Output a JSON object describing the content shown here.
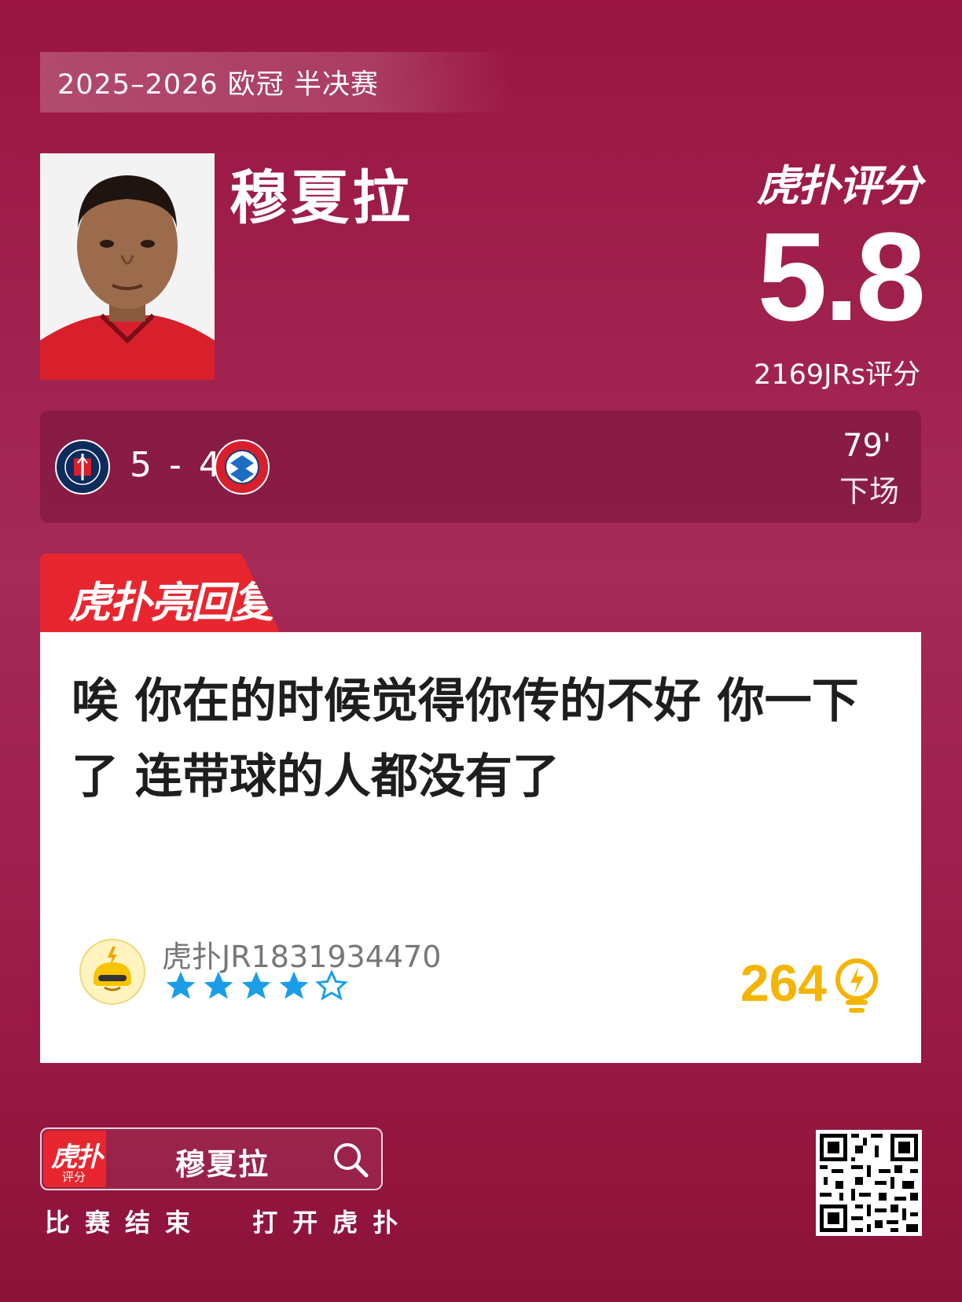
{
  "header": {
    "season": "2025–2026 欧冠 半决赛"
  },
  "player": {
    "name": "穆夏拉"
  },
  "rating": {
    "brand": "虎扑评分",
    "score": "5.8",
    "votes": "2169JRs评分"
  },
  "match": {
    "home_crest": "psg-crest-icon",
    "away_crest": "bayern-crest-icon",
    "score": "5 - 4",
    "sub_minute": "79'",
    "sub_label": "下场"
  },
  "highlight": {
    "tab_label": "虎扑亮回复",
    "comment": "唉 你在的时候觉得你传的不好 你一下了 连带球的人都没有了",
    "username": "虎扑JR1831934470",
    "stars_filled": 4,
    "stars_total": 5,
    "likes": "264"
  },
  "footer": {
    "app_logo_text": "虎扑",
    "app_logo_sub": "评分",
    "search_text": "穆夏拉",
    "cta": "比赛结束  打开虎扑"
  },
  "colors": {
    "background": "#9a1541",
    "accent_red": "#e8262f",
    "star_blue": "#1a9ee8",
    "like_gold": "#f5b400"
  }
}
